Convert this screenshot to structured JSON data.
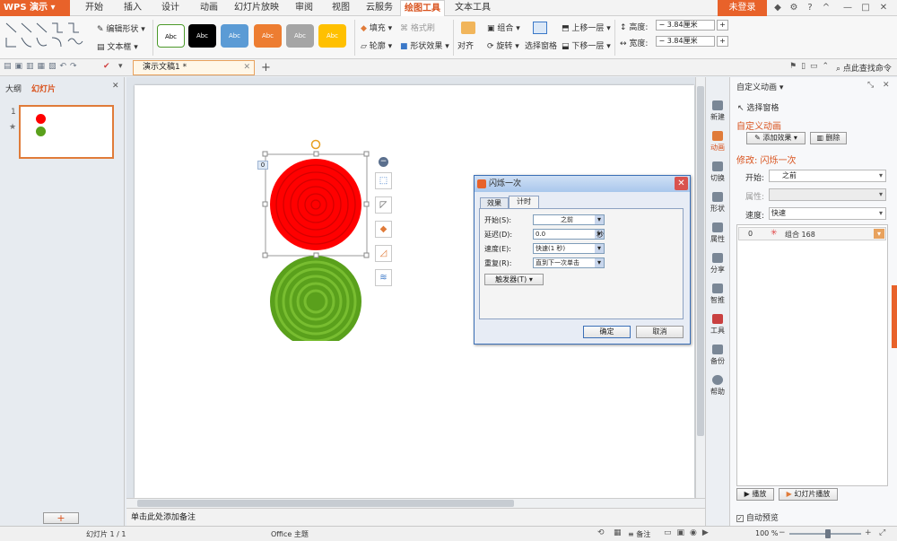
{
  "app": {
    "name": "WPS 演示"
  },
  "menu": {
    "tabs": [
      "开始",
      "插入",
      "设计",
      "动画",
      "幻灯片放映",
      "审阅",
      "视图",
      "云服务",
      "绘图工具",
      "文本工具"
    ],
    "active": "绘图工具",
    "login": "未登录"
  },
  "ribbon": {
    "edit_shape": "编辑形状",
    "textbox": "文本框",
    "swatch_label": "Abc",
    "fill": "填充",
    "format_painter": "格式刷",
    "outline": "轮廓",
    "shape_effect": "形状效果",
    "align": "对齐",
    "group": "组合",
    "rotate": "旋转",
    "selection_pane": "选择窗格",
    "bring_forward": "上移一层",
    "send_backward": "下移一层",
    "height_label": "高度:",
    "height_value": "3.84厘米",
    "width_label": "宽度:",
    "width_value": "3.84厘米",
    "swatch_colors": [
      "#ffffff",
      "#000000",
      "#5b9bd5",
      "#ed7d31",
      "#a5a5a5",
      "#ffc000"
    ]
  },
  "quickbar": {
    "doc_tab": "演示文稿1 *",
    "find_command": "点此查找命令"
  },
  "left_panel": {
    "tab_outline": "大纲",
    "tab_slides": "幻灯片",
    "slide_number": "1"
  },
  "canvas": {
    "selection_badge": "0",
    "red": "#ff0000",
    "green": "#5aa01c"
  },
  "dialog": {
    "title": "闪烁一次",
    "tab_effect": "效果",
    "tab_timing": "计时",
    "start_label": "开始(S):",
    "start_value": "之前",
    "delay_label": "延迟(D):",
    "delay_value": "0.0",
    "delay_unit": "秒",
    "speed_label": "速度(E):",
    "speed_value": "快速(1 秒)",
    "repeat_label": "重复(R):",
    "repeat_value": "直到下一次单击",
    "trigger": "触发器(T)",
    "ok": "确定",
    "cancel": "取消"
  },
  "side_tools": [
    "新建",
    "动画",
    "切换",
    "形状",
    "属性",
    "分享",
    "智推",
    "工具",
    "备份",
    "帮助"
  ],
  "right_panel": {
    "title": "自定义动画",
    "select_pane": "选择窗格",
    "heading": "自定义动画",
    "add_effect": "添加效果",
    "delete": "删除",
    "modify": "修改: 闪烁一次",
    "start_label": "开始:",
    "start_value": "之前",
    "property_label": "属性:",
    "speed_label": "速度:",
    "speed_value": "快速",
    "item_index": "0",
    "item_name": "组合 168",
    "play": "播放",
    "slideshow": "幻灯片播放",
    "autopreview": "自动预览"
  },
  "notes": "单击此处添加备注",
  "status": {
    "slide_info": "幻灯片 1 / 1",
    "theme": "Office 主题",
    "notes_btn": "备注",
    "zoom": "100 %"
  }
}
